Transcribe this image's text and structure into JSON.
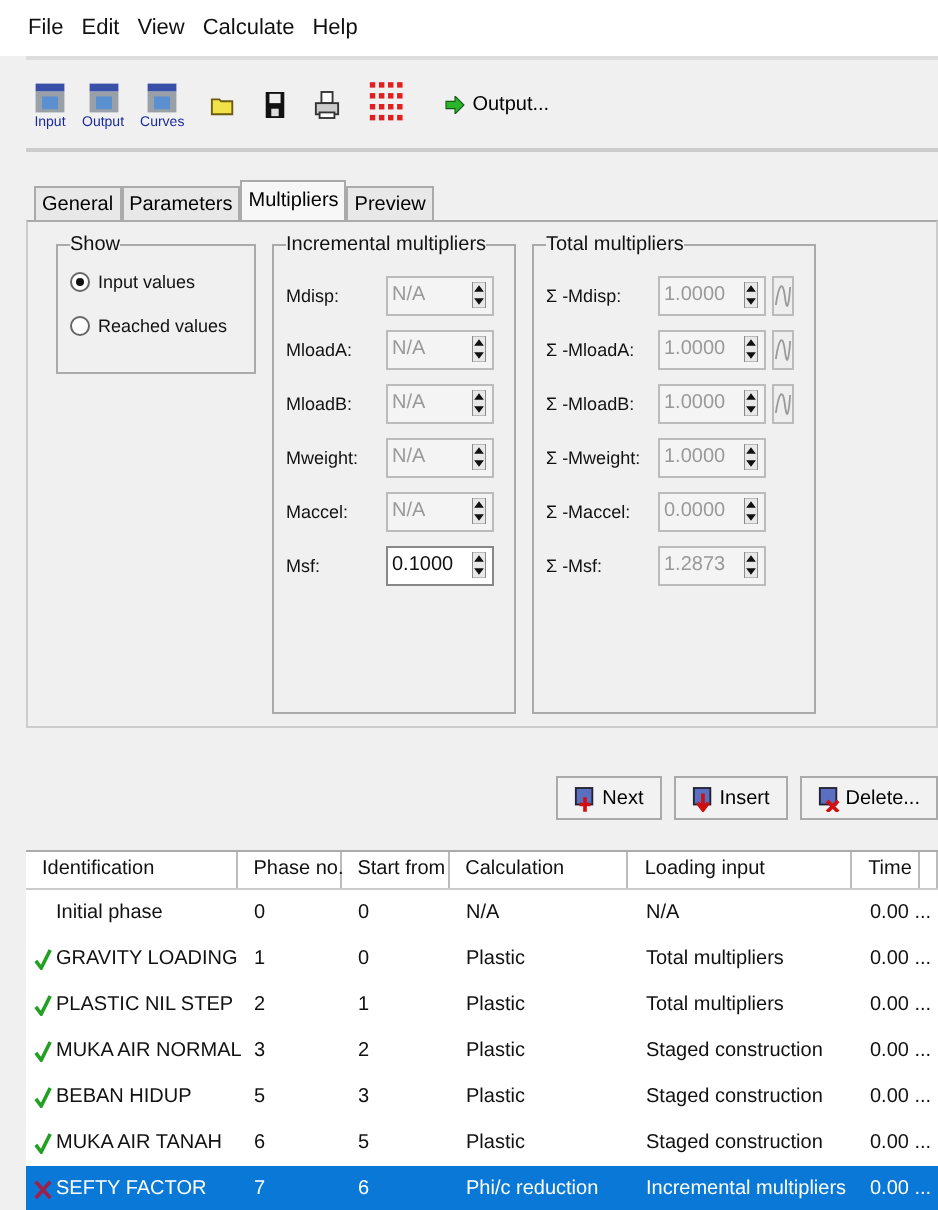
{
  "menu": [
    "File",
    "Edit",
    "View",
    "Calculate",
    "Help"
  ],
  "toolbar": [
    {
      "kind": "big",
      "label": "Input"
    },
    {
      "kind": "big",
      "label": "Output"
    },
    {
      "kind": "big",
      "label": "Curves"
    },
    {
      "kind": "open"
    },
    {
      "kind": "save"
    },
    {
      "kind": "print"
    },
    {
      "kind": "points"
    },
    {
      "kind": "go",
      "label": "Output..."
    }
  ],
  "tabs": [
    {
      "label": "General",
      "selected": false
    },
    {
      "label": "Parameters",
      "selected": false
    },
    {
      "label": "Multipliers",
      "selected": true
    },
    {
      "label": "Preview",
      "selected": false
    }
  ],
  "show": {
    "title": "Show",
    "options": [
      {
        "label": "Input values",
        "selected": true
      },
      {
        "label": "Reached values",
        "selected": false
      }
    ]
  },
  "incremental": {
    "title": "Incremental multipliers",
    "rows": [
      {
        "label": "Mdisp:",
        "value": "N/A",
        "disabled": true
      },
      {
        "label": "MloadA:",
        "value": "N/A",
        "disabled": true
      },
      {
        "label": "MloadB:",
        "value": "N/A",
        "disabled": true
      },
      {
        "label": "Mweight:",
        "value": "N/A",
        "disabled": true
      },
      {
        "label": "Maccel:",
        "value": "N/A",
        "disabled": true
      },
      {
        "label": "Msf:",
        "value": "0.1000",
        "disabled": false
      }
    ]
  },
  "total": {
    "title": "Total multipliers",
    "rows": [
      {
        "label": "Σ -Mdisp:",
        "value": "1.0000",
        "disabled": true,
        "curve": true
      },
      {
        "label": "Σ -MloadA:",
        "value": "1.0000",
        "disabled": true,
        "curve": true
      },
      {
        "label": "Σ -MloadB:",
        "value": "1.0000",
        "disabled": true,
        "curve": true
      },
      {
        "label": "Σ -Mweight:",
        "value": "1.0000",
        "disabled": true,
        "curve": false
      },
      {
        "label": "Σ -Maccel:",
        "value": "0.0000",
        "disabled": true,
        "curve": false
      },
      {
        "label": "Σ -Msf:",
        "value": "1.2873",
        "disabled": true,
        "curve": false
      }
    ]
  },
  "buttons": [
    {
      "kind": "next",
      "label": "Next"
    },
    {
      "kind": "insert",
      "label": "Insert"
    },
    {
      "kind": "delete",
      "label": "Delete..."
    }
  ],
  "table": {
    "columns": [
      "Identification",
      "Phase no.",
      "Start from",
      "Calculation",
      "Loading input",
      "Time"
    ],
    "rows": [
      {
        "kind": "plain",
        "selected": false,
        "cells": [
          "Initial phase",
          "0",
          "0",
          "N/A",
          "N/A",
          "0.00 ..."
        ]
      },
      {
        "kind": "done",
        "selected": false,
        "cells": [
          "GRAVITY LOADING",
          "1",
          "0",
          "Plastic",
          "Total multipliers",
          "0.00 ..."
        ]
      },
      {
        "kind": "done",
        "selected": false,
        "cells": [
          "PLASTIC NIL STEP",
          "2",
          "1",
          "Plastic",
          "Total multipliers",
          "0.00 ..."
        ]
      },
      {
        "kind": "done",
        "selected": false,
        "cells": [
          "MUKA AIR NORMAL",
          "3",
          "2",
          "Plastic",
          "Staged construction",
          "0.00 ..."
        ]
      },
      {
        "kind": "done",
        "selected": false,
        "cells": [
          "BEBAN HIDUP",
          "5",
          "3",
          "Plastic",
          "Staged construction",
          "0.00 ..."
        ]
      },
      {
        "kind": "done",
        "selected": false,
        "cells": [
          "MUKA AIR TANAH",
          "6",
          "5",
          "Plastic",
          "Staged construction",
          "0.00 ..."
        ]
      },
      {
        "kind": "failed",
        "selected": true,
        "cells": [
          "SEFTY FACTOR",
          "7",
          "6",
          "Phi/c reduction",
          "Incremental multipliers",
          "0.00 ..."
        ]
      }
    ]
  }
}
